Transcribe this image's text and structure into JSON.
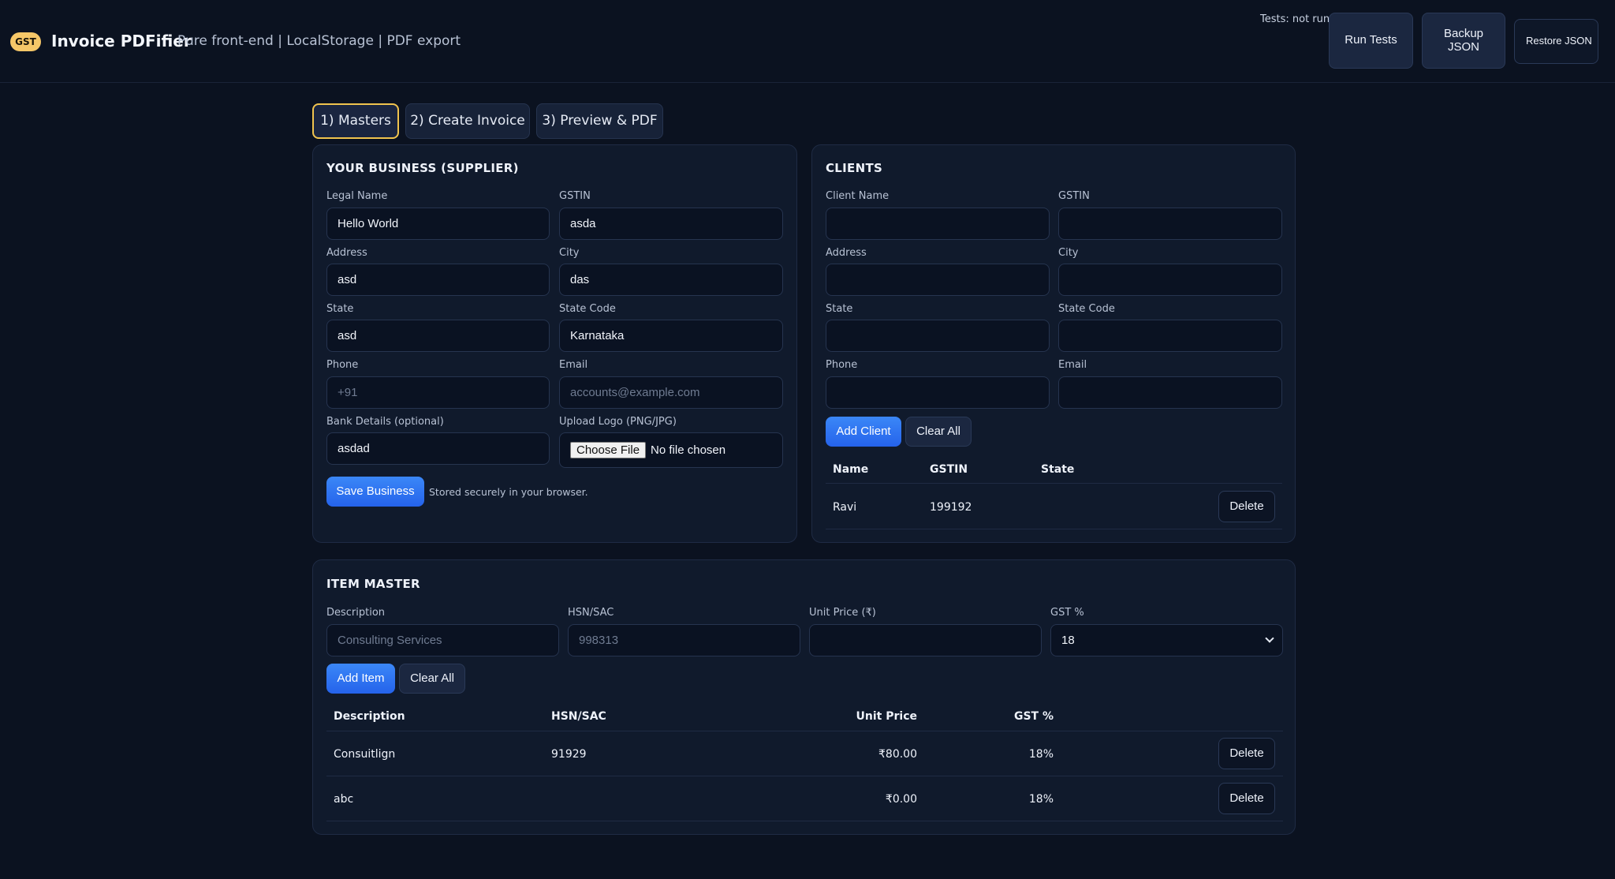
{
  "header": {
    "badge": "GST",
    "title": "Invoice PDFifier",
    "subtitle": "Pure front-end | LocalStorage | PDF export",
    "tests_status": "Tests: not run",
    "run_tests_label": "Run Tests",
    "backup_label": "Backup JSON",
    "restore_label": "Restore JSON"
  },
  "tabs": [
    {
      "label": "1) Masters",
      "active": true
    },
    {
      "label": "2) Create Invoice",
      "active": false
    },
    {
      "label": "3) Preview & PDF",
      "active": false
    }
  ],
  "business": {
    "title": "YOUR BUSINESS (SUPPLIER)",
    "fields": {
      "legal_name": {
        "label": "Legal Name",
        "value": "Hello World",
        "placeholder": ""
      },
      "gstin": {
        "label": "GSTIN",
        "value": "asda",
        "placeholder": ""
      },
      "address": {
        "label": "Address",
        "value": "asd",
        "placeholder": ""
      },
      "city": {
        "label": "City",
        "value": "das",
        "placeholder": ""
      },
      "state": {
        "label": "State",
        "value": "asd",
        "placeholder": ""
      },
      "state_code": {
        "label": "State Code",
        "value": "Karnataka",
        "placeholder": ""
      },
      "phone": {
        "label": "Phone",
        "value": "",
        "placeholder": "+91"
      },
      "email": {
        "label": "Email",
        "value": "",
        "placeholder": "accounts@example.com"
      },
      "bank": {
        "label": "Bank Details (optional)",
        "value": "asdad",
        "placeholder": ""
      },
      "logo": {
        "label": "Upload Logo (PNG/JPG)",
        "button": "Choose File",
        "status": "No file chosen"
      }
    },
    "save_label": "Save Business",
    "save_hint": "Stored securely in your browser."
  },
  "clients": {
    "title": "CLIENTS",
    "fields": {
      "name": {
        "label": "Client Name",
        "value": ""
      },
      "gstin": {
        "label": "GSTIN",
        "value": ""
      },
      "address": {
        "label": "Address",
        "value": ""
      },
      "city": {
        "label": "City",
        "value": ""
      },
      "state": {
        "label": "State",
        "value": ""
      },
      "state_code": {
        "label": "State Code",
        "value": ""
      },
      "phone": {
        "label": "Phone",
        "value": ""
      },
      "email": {
        "label": "Email",
        "value": ""
      }
    },
    "add_label": "Add Client",
    "clear_label": "Clear All",
    "columns": [
      "Name",
      "GSTIN",
      "State"
    ],
    "rows": [
      {
        "name": "Ravi",
        "gstin": "199192",
        "state": "",
        "action": "Delete"
      }
    ]
  },
  "items": {
    "title": "ITEM MASTER",
    "fields": {
      "description": {
        "label": "Description",
        "value": "",
        "placeholder": "Consulting Services"
      },
      "hsn": {
        "label": "HSN/SAC",
        "value": "",
        "placeholder": "998313"
      },
      "unit_price": {
        "label": "Unit Price (₹)",
        "value": "",
        "placeholder": ""
      },
      "gst": {
        "label": "GST %",
        "value": "18"
      }
    },
    "add_label": "Add Item",
    "clear_label": "Clear All",
    "columns": [
      "Description",
      "HSN/SAC",
      "Unit Price",
      "GST %"
    ],
    "rows": [
      {
        "description": "Consuitlign",
        "hsn": "91929",
        "price": "₹80.00",
        "gst": "18%",
        "action": "Delete"
      },
      {
        "description": "abc",
        "hsn": "",
        "price": "₹0.00",
        "gst": "18%",
        "action": "Delete"
      }
    ]
  }
}
